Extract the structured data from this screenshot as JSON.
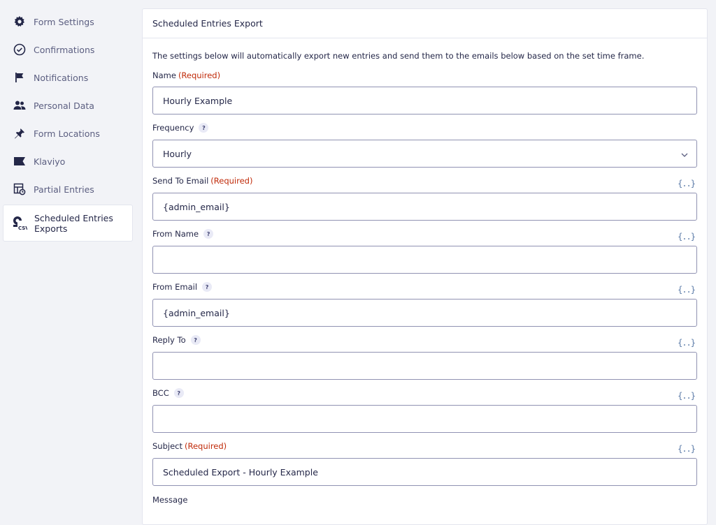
{
  "sidebar": {
    "items": [
      {
        "label": "Form Settings",
        "icon": "gear-icon"
      },
      {
        "label": "Confirmations",
        "icon": "check-circle-icon"
      },
      {
        "label": "Notifications",
        "icon": "flag-icon"
      },
      {
        "label": "Personal Data",
        "icon": "users-icon"
      },
      {
        "label": "Form Locations",
        "icon": "pin-icon"
      },
      {
        "label": "Klaviyo",
        "icon": "klaviyo-flag-icon"
      },
      {
        "label": "Partial Entries",
        "icon": "partial-entries-icon"
      },
      {
        "label": "Scheduled Entries Exports",
        "icon": "csv-export-icon",
        "active": true
      }
    ]
  },
  "panel": {
    "title": "Scheduled Entries Export",
    "description": "The settings below will automatically export new entries and send them to the emails below based on the set time frame.",
    "required_text": "(Required)",
    "help_glyph": "?",
    "merge_tag_glyph": "{..}",
    "fields": {
      "name": {
        "label": "Name",
        "value": "Hourly Example"
      },
      "frequency": {
        "label": "Frequency",
        "value": "Hourly"
      },
      "send_to": {
        "label": "Send To Email",
        "value": "{admin_email}"
      },
      "from_name": {
        "label": "From Name",
        "value": ""
      },
      "from_email": {
        "label": "From Email",
        "value": "{admin_email}"
      },
      "reply_to": {
        "label": "Reply To",
        "value": ""
      },
      "bcc": {
        "label": "BCC",
        "value": ""
      },
      "subject": {
        "label": "Subject",
        "value": "Scheduled Export - Hourly Example"
      },
      "message": {
        "label": "Message"
      }
    }
  }
}
